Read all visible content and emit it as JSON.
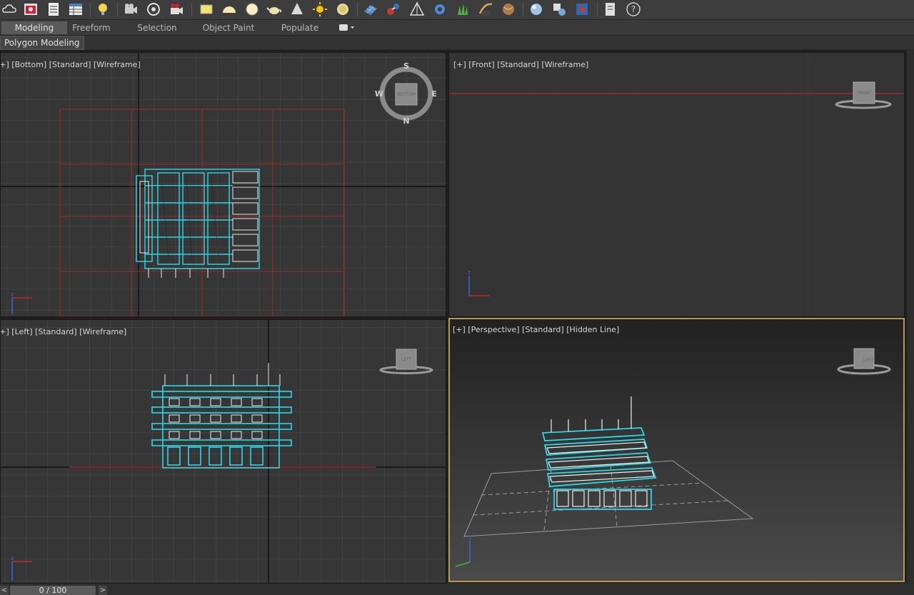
{
  "ribbon": {
    "tabs": [
      {
        "label": "Modeling"
      },
      {
        "label": "Freeform"
      },
      {
        "label": "Selection"
      },
      {
        "label": "Object Paint"
      },
      {
        "label": "Populate"
      }
    ]
  },
  "subpanel": {
    "label": "Polygon Modeling"
  },
  "viewports": {
    "top_left": {
      "label": "[+] [Bottom] [Standard] [Wireframe]",
      "compass": {
        "n": "N",
        "s": "S",
        "e": "E",
        "w": "W"
      },
      "cube_label": "BOTTOM"
    },
    "top_right": {
      "label": "[+] [Front] [Standard] [Wireframe]",
      "cube_label": "FRONT"
    },
    "bottom_left": {
      "label": "[+] [Left] [Standard] [Wireframe]",
      "cube_label": "LEFT"
    },
    "bottom_right": {
      "label": "[+] [Perspective] [Standard] [Hidden Line]",
      "cube_label": "LEFT"
    }
  },
  "timeline": {
    "frame": "0 / 100",
    "prev": "<",
    "next": ">"
  },
  "colors": {
    "accent": "#b69a4e",
    "selection": "#29d6e6",
    "grid": "#4a4a4a",
    "axis_red": "#b02a2a"
  }
}
